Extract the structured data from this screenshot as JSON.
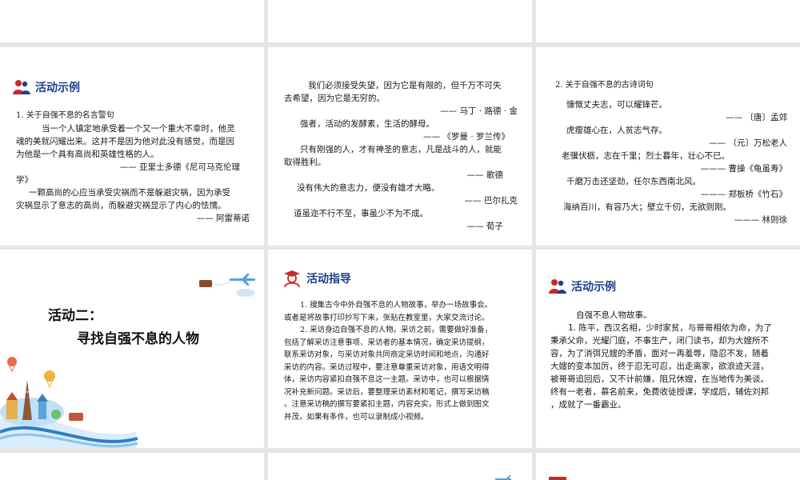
{
  "slides": {
    "s_r1c1": {
      "header": "活动示例",
      "lines": [
        "1. 关于自强不息的名言警句",
        "当一个人镇定地承受着一个又一个重大不幸时，他灵",
        "魂的美就闪耀出来。这并不是因为他对此没有感觉，而是因",
        "为他是一个具有高尚和英雄性格的人。",
        "—— 亚里士多德《尼可马克伦理",
        "学》",
        "一颗高尚的心应当承受灾祸而不是躲避灾祸，因为承受",
        "灾祸显示了意志的高尚，而躲避灾祸显示了内心的怯懦。",
        "—— 阿雷蒂诺"
      ]
    },
    "s_r1c2": {
      "lines": [
        "我们必须接受失望，因为它是有限的，但千万不可失",
        "去希望，因为它是无穷的。",
        "—— 马丁 · 路德 · 金",
        "强者，活动的发酵素，生活的酵母。",
        "—— 《罗曼 · 罗兰传》",
        "只有刚强的人，才有神圣的意志，凡是战斗的人，就能",
        "取得胜利。",
        "—— 歌德",
        "没有伟大的意志力，便没有雄才大略。",
        "—— 巴尔扎克",
        "道虽迩不行不至，事虽少不为不成。",
        "—— 荀子"
      ]
    },
    "s_r1c3": {
      "lines": [
        "2. 关于自强不息的古诗词句",
        "慷慨丈夫志，可以耀锋芒。",
        "—— 〔唐〕孟郊",
        "虎瘦雄心在，人贫志气存。",
        "—— 〔元〕万松老人",
        "老骥伏枥，志在千里；烈士暮年，壮心不已。",
        "——— 曹操《龟虽寿》",
        "千磨万击还坚劲，任尔东西南北风。",
        "——— 郑板桥《竹石》",
        "海纳百川，有容乃大；壁立千仞，无欲则刚。",
        "——— 林则徐"
      ]
    },
    "s_r2c1": {
      "title_line1": "活动二：",
      "title_line2": "寻找自强不息的人物"
    },
    "s_r2c2": {
      "header": "活动指导",
      "lines": [
        "1. 搜集古今中外自强不息的人物故事，举办一场故事会。",
        "或者是将故事打印抄写下来，张贴在教室里，大家交流讨论。",
        "2. 采访身边自强不息的人物。采访之前，需要做好准备，",
        "包括了解采访注意事项、采访者的基本情况，确定采访提纲，",
        "联系采访对象，与采访对象共同商定采访时间和地点，沟通好",
        "采访的内容。采访过程中，要注意尊重采访对象，用语文明得",
        "体，采访内容紧扣自强不息这一主题。采访中，也可以根据情",
        "况补充新问题。采访后，要整理采访素材和笔记，撰写采访稿",
        "。注意采访稿的撰写要紧扣主题，内容充实，形式上做到图文",
        "并茂，如果有条件，也可以录制成小视频。"
      ]
    },
    "s_r2c3": {
      "header": "活动示例",
      "lines": [
        "自强不息人物故事。",
        "1. 陈平，西汉名相，少时家贫，与哥哥相依为命，为了",
        "秉承父命，光耀门庭，不事生产，闭门读书，却为大嫂所不",
        "容，为了消弭兄嫂的矛盾，面对一再羞辱，隐忍不发，随着",
        "大嫂的变本加厉，终于忍无可忍，出走离家，欲浪迹天涯，",
        "被哥哥追回后，又不计前嫌，阻兄休嫂，在当地传为美谈。",
        "终有一老者，慕名前来，免费收徒授课，学成后，辅佐刘邦",
        "，成就了一番霸业。"
      ]
    }
  },
  "colors": {
    "header_text": "#1f3d8a",
    "icon_red": "#c8282a"
  }
}
